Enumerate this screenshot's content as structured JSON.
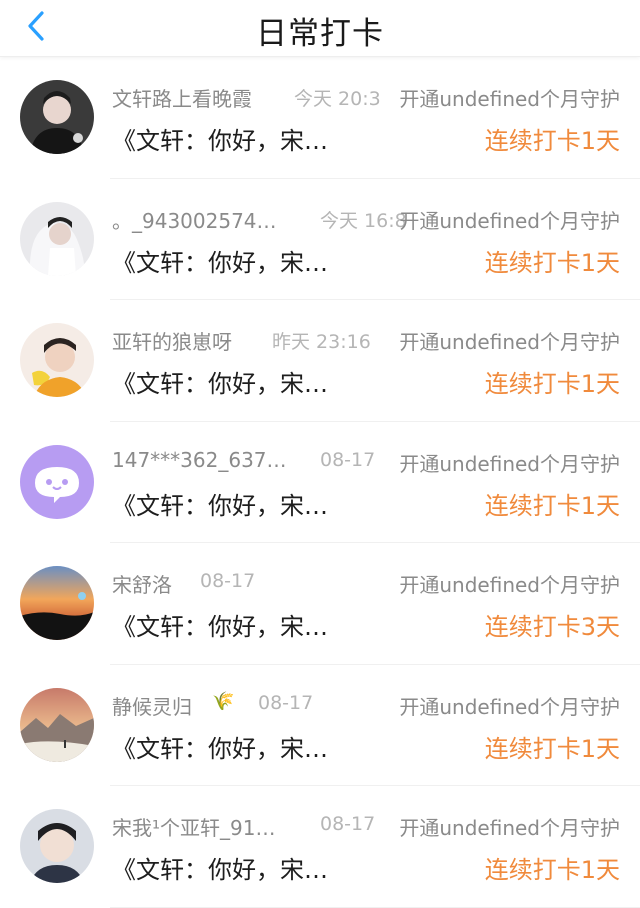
{
  "header": {
    "title": "日常打卡",
    "back_icon": "chevron-left-icon",
    "accent": "#2aa0ff"
  },
  "colors": {
    "streak": "#f08a3c",
    "muted": "#8a8a8a",
    "time": "#b5b5b5"
  },
  "rows": [
    {
      "name": "文轩路上看晚霞",
      "time": "今天 20:3",
      "guard": "开通undefined个月守护",
      "message": "《文轩：你好，宋…",
      "streak": "连续打卡1天"
    },
    {
      "name": "。_943002574…",
      "time": "今天 16:8",
      "guard": "开通undefined个月守护",
      "message": "《文轩：你好，宋…",
      "streak": "连续打卡1天"
    },
    {
      "name": "亚轩的狼崽呀",
      "time": "昨天 23:16",
      "guard": "开通undefined个月守护",
      "message": "《文轩：你好，宋…",
      "streak": "连续打卡1天"
    },
    {
      "name": "147***362_637…",
      "time": "08-17",
      "guard": "开通undefined个月守护",
      "message": "《文轩：你好，宋…",
      "streak": "连续打卡1天"
    },
    {
      "name": "宋舒洛",
      "time": "08-17",
      "guard": "开通undefined个月守护",
      "message": "《文轩：你好，宋…",
      "streak": "连续打卡3天"
    },
    {
      "name": "静候灵归",
      "name_emoji": "🌾",
      "time": "08-17",
      "guard": "开通undefined个月守护",
      "message": "《文轩：你好，宋…",
      "streak": "连续打卡1天"
    },
    {
      "name": "宋我¹个亚轩_91…",
      "time": "08-17",
      "guard": "开通undefined个月守护",
      "message": "《文轩：你好，宋…",
      "streak": "连续打卡1天"
    }
  ]
}
